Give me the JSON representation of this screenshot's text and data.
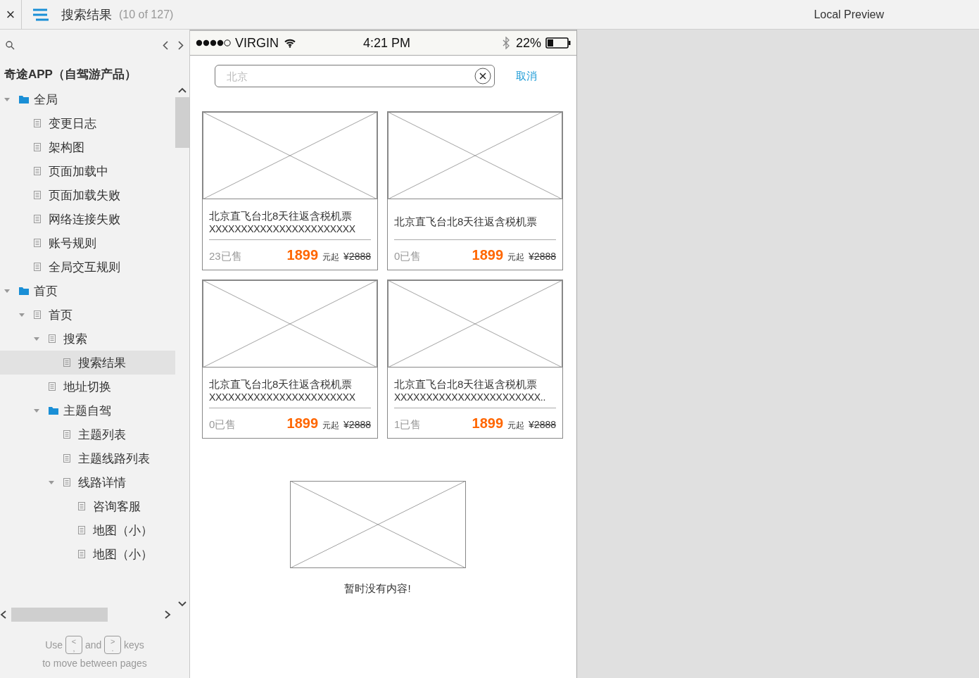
{
  "topbar": {
    "close": "×",
    "page_title": "搜索结果",
    "page_count": "(10 of 127)",
    "preview_title": "Local Preview"
  },
  "sidebar": {
    "project": "奇途APP（自驾游产品）",
    "tree": [
      {
        "label": "全局",
        "kind": "folder",
        "expanded": true,
        "selected": false,
        "children": [
          {
            "label": "变更日志",
            "kind": "page",
            "selected": false
          },
          {
            "label": "架构图",
            "kind": "page",
            "selected": false
          },
          {
            "label": "页面加载中",
            "kind": "page",
            "selected": false
          },
          {
            "label": "页面加载失败",
            "kind": "page",
            "selected": false
          },
          {
            "label": "网络连接失败",
            "kind": "page",
            "selected": false
          },
          {
            "label": "账号规则",
            "kind": "page",
            "selected": false
          },
          {
            "label": "全局交互规则",
            "kind": "page",
            "selected": false
          }
        ]
      },
      {
        "label": "首页",
        "kind": "folder",
        "expanded": true,
        "selected": false,
        "children": [
          {
            "label": "首页",
            "kind": "page",
            "expanded": true,
            "selected": false,
            "children": [
              {
                "label": "搜索",
                "kind": "page",
                "expanded": true,
                "selected": false,
                "children": [
                  {
                    "label": "搜索结果",
                    "kind": "page",
                    "selected": true
                  }
                ]
              },
              {
                "label": "地址切换",
                "kind": "page",
                "selected": false
              },
              {
                "label": "主题自驾",
                "kind": "folder",
                "expanded": true,
                "selected": false,
                "children": [
                  {
                    "label": "主题列表",
                    "kind": "page",
                    "selected": false
                  },
                  {
                    "label": "主题线路列表",
                    "kind": "page",
                    "selected": false
                  },
                  {
                    "label": "线路详情",
                    "kind": "page",
                    "expanded": true,
                    "selected": false,
                    "children": [
                      {
                        "label": "咨询客服",
                        "kind": "page",
                        "selected": false
                      },
                      {
                        "label": "地图（小）",
                        "kind": "page",
                        "selected": false
                      },
                      {
                        "label": "地图（小）",
                        "kind": "page",
                        "selected": false
                      }
                    ]
                  }
                ]
              }
            ]
          }
        ]
      }
    ],
    "hint": {
      "use": "Use",
      "key_prev": {
        "top": "<",
        "bottom": ","
      },
      "and": "and",
      "key_next": {
        "top": ">",
        "bottom": "."
      },
      "keys": "keys",
      "line2": "to move between pages"
    }
  },
  "phone": {
    "status_bar": {
      "carrier": "VIRGIN",
      "time": "4:21 PM",
      "battery": "22%"
    },
    "search": {
      "placeholder": "北京",
      "cancel": "取消"
    },
    "products": [
      {
        "title": "北京直飞台北8天往返含税机票",
        "subtitle": "XXXXXXXXXXXXXXXXXXXXXXX",
        "sold": "23已售",
        "price": "1899",
        "price_unit": "元起",
        "currency": "¥",
        "old_price": "2888"
      },
      {
        "title": "北京直飞台北8天往返含税机票",
        "sold": "0已售",
        "price": "1899",
        "price_unit": "元起",
        "currency": "¥",
        "old_price": "2888"
      },
      {
        "title": "北京直飞台北8天往返含税机票",
        "subtitle": "XXXXXXXXXXXXXXXXXXXXXXX",
        "sold": "0已售",
        "price": "1899",
        "price_unit": "元起",
        "currency": "¥",
        "old_price": "2888"
      },
      {
        "title": "北京直飞台北8天往返含税机票",
        "subtitle": "XXXXXXXXXXXXXXXXXXXXXXX..",
        "sold": "1已售",
        "price": "1899",
        "price_unit": "元起",
        "currency": "¥",
        "old_price": "2888"
      }
    ],
    "empty_message": "暂时没有内容!"
  }
}
